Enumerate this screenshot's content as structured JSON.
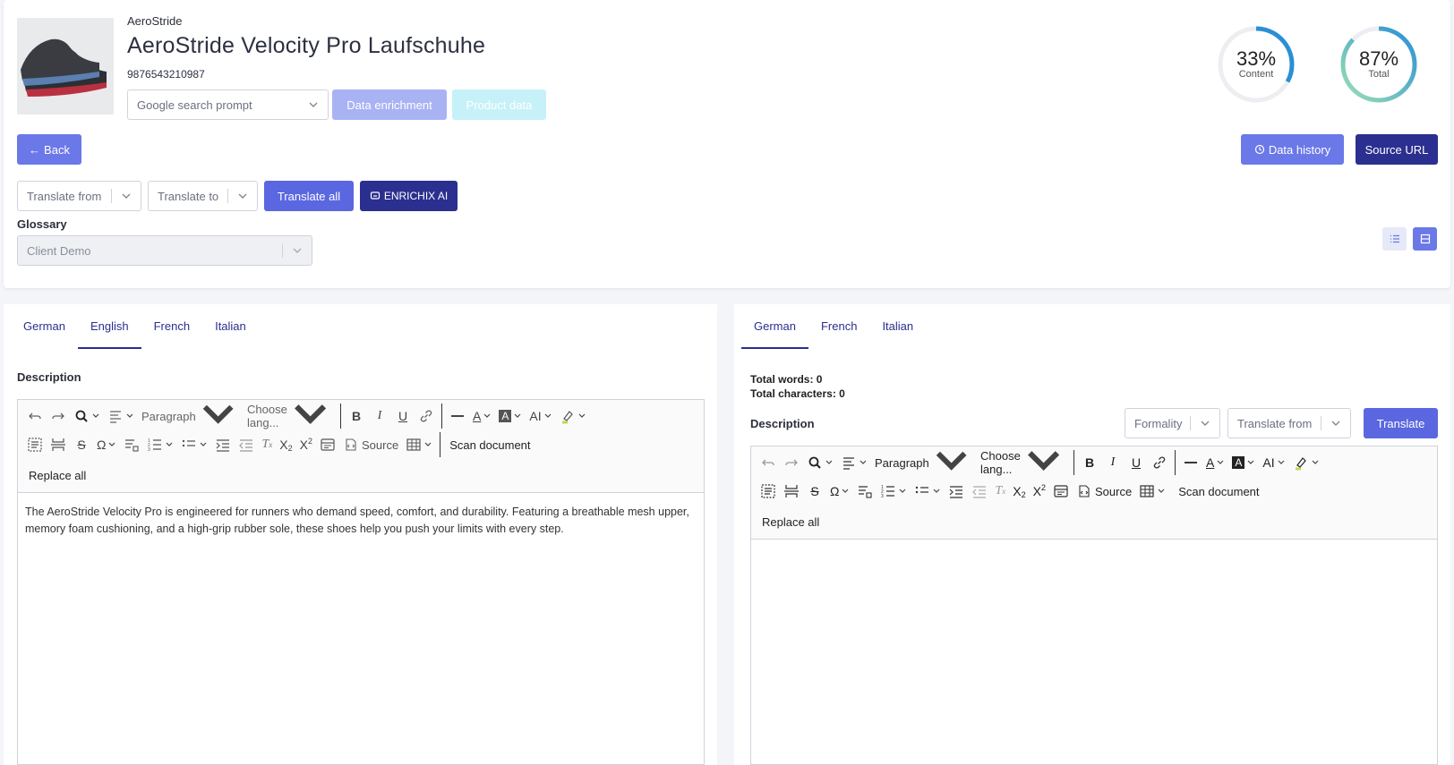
{
  "product": {
    "brand": "AeroStride",
    "title": "AeroStride Velocity Pro Laufschuhe",
    "ean": "9876543210987"
  },
  "actions": {
    "prompt_select": "Google search prompt",
    "data_enrichment": "Data enrichment",
    "product_data": "Product data",
    "back": "Back",
    "data_history": "Data history",
    "source_url": "Source URL",
    "translate_from": "Translate from",
    "translate_to": "Translate to",
    "translate_all": "Translate all",
    "enrichix_ai": "ENRICHIX AI"
  },
  "gauges": {
    "content": {
      "value": "33%",
      "label": "Content",
      "fraction": 0.33,
      "color": "#2a8fd6"
    },
    "total": {
      "value": "87%",
      "label": "Total",
      "fraction": 0.87,
      "color": "#2a8fd6"
    }
  },
  "glossary": {
    "label": "Glossary",
    "value": "Client Demo"
  },
  "left_panel": {
    "tabs": [
      "German",
      "English",
      "French",
      "Italian"
    ],
    "active_tab": "English",
    "description_label": "Description",
    "toolbar": {
      "paragraph": "Paragraph",
      "choose_lang": "Choose lang...",
      "source": "Source",
      "scan_document": "Scan document",
      "replace_all": "Replace all"
    },
    "content": "The AeroStride Velocity Pro is engineered for runners who demand speed, comfort, and durability. Featuring a breathable mesh upper, memory foam cushioning, and a high-grip rubber sole, these shoes help you push your limits with every step."
  },
  "right_panel": {
    "tabs": [
      "German",
      "French",
      "Italian"
    ],
    "active_tab": "German",
    "total_words": "Total words: 0",
    "total_characters": "Total characters: 0",
    "description_label": "Description",
    "formality": "Formality",
    "translate_from": "Translate from",
    "translate": "Translate",
    "toolbar": {
      "paragraph": "Paragraph",
      "choose_lang": "Choose lang...",
      "source": "Source",
      "scan_document": "Scan document",
      "replace_all": "Replace all"
    },
    "content": ""
  },
  "colors": {
    "primary": "#6a78e8",
    "dark": "#2b2f8f",
    "enrich_disabled": "#a9b3f3",
    "product_disabled": "#c7f1f8"
  }
}
